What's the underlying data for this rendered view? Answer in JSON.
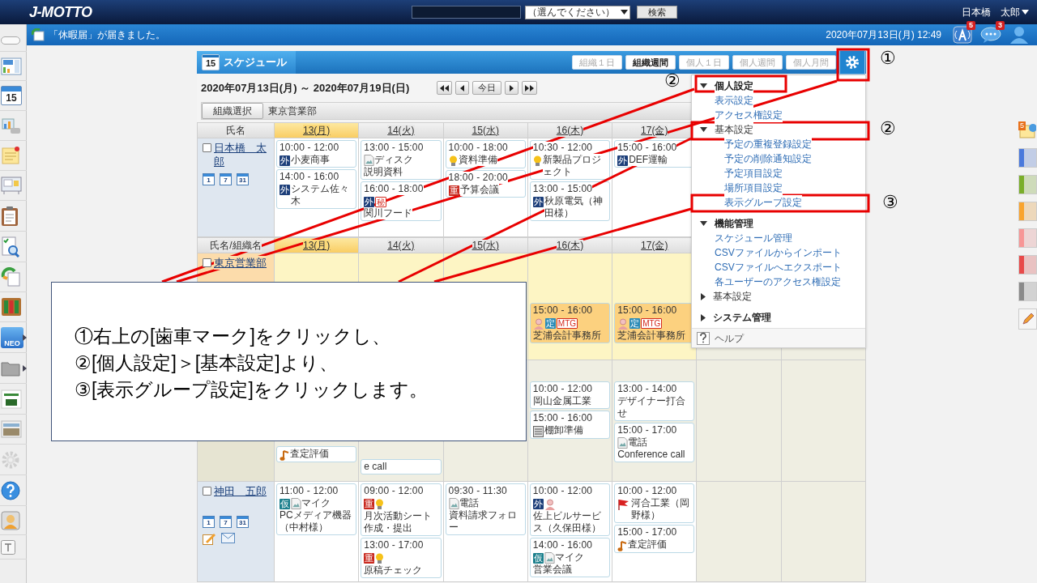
{
  "top_bar": {
    "logo": "J-MOTTO",
    "select": "（選んでください）",
    "search_button": "検索",
    "user": "日本橋　太郎"
  },
  "sidebar": {
    "items": [
      {
        "kind": "toggle",
        "submenu": false
      },
      {
        "kind": "portal",
        "submenu": false
      },
      {
        "kind": "calendar",
        "text": "15",
        "submenu": false
      },
      {
        "kind": "chart",
        "submenu": false
      },
      {
        "kind": "memo",
        "submenu": false
      },
      {
        "kind": "board",
        "submenu": false
      },
      {
        "kind": "clipboard",
        "submenu": false
      },
      {
        "kind": "search",
        "submenu": false
      },
      {
        "kind": "recycle",
        "submenu": false
      },
      {
        "kind": "binders",
        "submenu": false
      },
      {
        "kind": "neo",
        "text": "NEO",
        "submenu": true
      },
      {
        "kind": "folder",
        "submenu": true
      },
      {
        "kind": "banner",
        "submenu": false
      },
      {
        "kind": "photo",
        "submenu": false
      },
      {
        "kind": "gear",
        "submenu": false
      },
      {
        "kind": "help",
        "submenu": false
      },
      {
        "kind": "support",
        "submenu": false
      },
      {
        "kind": "text",
        "submenu": false
      }
    ]
  },
  "notice_bar": {
    "message": "「休暇届」が届きました。",
    "datetime": "2020年07月13日(月) 12:49",
    "icons": [
      {
        "kind": "antenna",
        "badge": "5"
      },
      {
        "kind": "chat",
        "badge": "3"
      },
      {
        "kind": "user"
      }
    ]
  },
  "schedule": {
    "calendar_day": "15",
    "title": "スケジュール",
    "views": [
      {
        "label": "組織１日",
        "selected": false
      },
      {
        "label": "組織週間",
        "selected": true
      },
      {
        "label": "個人１日",
        "selected": false
      },
      {
        "label": "個人週間",
        "selected": false
      },
      {
        "label": "個人月間",
        "selected": false
      }
    ],
    "range": "2020年07月13日(月) ～ 2020年07月19日(日)",
    "today_button": "今日",
    "org_button": "組織選択",
    "org": "東京営業部",
    "sections": [
      {
        "header": "氏名",
        "days": [
          {
            "label": "13(月)",
            "today": true
          },
          {
            "label": "14(火)",
            "today": false
          },
          {
            "label": "15(水)",
            "today": false
          },
          {
            "label": "16(木)",
            "today": false
          },
          {
            "label": "17(金)",
            "today": false
          }
        ],
        "rows": [
          {
            "kind": "person",
            "name": "日本橋　太郎",
            "checked": false,
            "links": [
              "1",
              "7",
              "31"
            ],
            "cells": [
              [
                {
                  "color": "#ffffff",
                  "time": "10:00 - 12:00",
                  "marks": [
                    {
                      "kind": "tag",
                      "text": "外",
                      "color": "#1d3f7a"
                    }
                  ],
                  "title": "小麦商事"
                },
                {
                  "color": "#ffffff",
                  "time": "14:00 - 16:00",
                  "marks": [
                    {
                      "kind": "tag",
                      "text": "外",
                      "color": "#1d3f7a"
                    }
                  ],
                  "title": "システム佐々木"
                }
              ],
              [
                {
                  "color": "#ffffff",
                  "time": "13:00 - 15:00",
                  "marks": [
                    {
                      "kind": "image",
                      "alt": "ディスク"
                    }
                  ],
                  "title": "説明資料"
                },
                {
                  "color": "#ffffff",
                  "time": "16:00 - 18:00",
                  "marks": [
                    {
                      "kind": "tag",
                      "text": "外",
                      "color": "#1d3f7a"
                    },
                    {
                      "kind": "outline",
                      "text": "秘",
                      "color": "#d42a1e"
                    }
                  ],
                  "title": "関川フード"
                }
              ],
              [
                {
                  "color": "#ffffff",
                  "time": "10:00 - 18:00",
                  "marks": [
                    {
                      "kind": "bulb"
                    }
                  ],
                  "title": "資料準備"
                },
                {
                  "color": "#ffffff",
                  "time": "18:00 - 20:00",
                  "marks": [
                    {
                      "kind": "tag",
                      "text": "重",
                      "color": "#c8281e"
                    }
                  ],
                  "title": "予算会議"
                }
              ],
              [
                {
                  "color": "#ffffff",
                  "time": "10:30 - 12:00",
                  "marks": [
                    {
                      "kind": "bulb"
                    }
                  ],
                  "title": "新製品プロジェクト"
                },
                {
                  "color": "#ffffff",
                  "time": "13:00 - 15:00",
                  "marks": [
                    {
                      "kind": "tag",
                      "text": "外",
                      "color": "#1d3f7a"
                    }
                  ],
                  "title": "秋原電気（神田様）"
                }
              ],
              [
                {
                  "color": "#ffffff",
                  "time": "15:00 - 16:00",
                  "marks": [
                    {
                      "kind": "tag",
                      "text": "外",
                      "color": "#1d3f7a"
                    }
                  ],
                  "title": "DEF運輸"
                }
              ]
            ]
          }
        ]
      },
      {
        "header": "氏名/組織名",
        "days": [
          {
            "label": "13(月)",
            "today": true
          },
          {
            "label": "14(火)",
            "today": false
          },
          {
            "label": "15(水)",
            "today": false
          },
          {
            "label": "16(木)",
            "today": false
          },
          {
            "label": "17(金)",
            "today": false
          }
        ],
        "rows": [
          {
            "kind": "group",
            "name": "東京営業部",
            "checked": false,
            "cells": [
              [],
              [],
              [],
              [
                {
                  "color": "#fcd17f",
                  "time": "15:00 - 16:00",
                  "marks": [
                    {
                      "kind": "person"
                    },
                    {
                      "kind": "tag",
                      "text": "定",
                      "color": "#2a8bb8"
                    },
                    {
                      "kind": "outline",
                      "text": "MTG",
                      "color": "#d42a1e"
                    }
                  ],
                  "title": "芝浦会計事務所"
                }
              ],
              [
                {
                  "color": "#fcd17f",
                  "time": "15:00 - 16:00",
                  "marks": [
                    {
                      "kind": "person"
                    },
                    {
                      "kind": "tag",
                      "text": "定",
                      "color": "#2a8bb8"
                    },
                    {
                      "kind": "outline",
                      "text": "MTG",
                      "color": "#d42a1e"
                    }
                  ],
                  "title": "芝浦会計事務所"
                }
              ]
            ]
          },
          {
            "kind": "covered",
            "cells": [
              [
                {
                  "color": "#ffffff",
                  "marks": [
                    {
                      "kind": "note"
                    }
                  ],
                  "title": "査定評価"
                }
              ],
              [
                {
                  "color": "#ffffff",
                  "title": "e call"
                }
              ],
              [],
              [
                {
                  "color": "#ffffff",
                  "time": "10:00 - 12:00",
                  "title": "岡山金属工業"
                },
                {
                  "color": "#ffffff",
                  "time": "15:00 - 16:00",
                  "marks": [
                    {
                      "kind": "stock"
                    }
                  ],
                  "title": "棚卸準備"
                }
              ],
              [
                {
                  "color": "#ffffff",
                  "time": "13:00 - 14:00",
                  "title": "デザイナー打合せ"
                },
                {
                  "color": "#ffffff",
                  "time": "15:00 - 17:00",
                  "marks": [
                    {
                      "kind": "image",
                      "alt": "電話"
                    }
                  ],
                  "title": "Conference call"
                }
              ]
            ]
          },
          {
            "kind": "person",
            "name": "神田　五郎",
            "checked": false,
            "links": [
              "1",
              "7",
              "31"
            ],
            "actions": [
              {
                "kind": "edit"
              },
              {
                "kind": "mail"
              }
            ],
            "cells": [
              [
                {
                  "color": "#ffffff",
                  "time": "11:00 - 12:00",
                  "marks": [
                    {
                      "kind": "tag",
                      "text": "仮",
                      "color": "#1b7f8c"
                    },
                    {
                      "kind": "image",
                      "alt": "マイク"
                    }
                  ],
                  "title": "PCメディア機器（中村様）"
                }
              ],
              [
                {
                  "color": "#ffffff",
                  "time": "09:00 - 12:00",
                  "marks": [
                    {
                      "kind": "tag",
                      "text": "重",
                      "color": "#c8281e"
                    },
                    {
                      "kind": "bulb"
                    }
                  ],
                  "title": "月次活動シート作成・提出"
                },
                {
                  "color": "#ffffff",
                  "time": "13:00 - 17:00",
                  "marks": [
                    {
                      "kind": "tag",
                      "text": "重",
                      "color": "#c8281e"
                    },
                    {
                      "kind": "bulb"
                    }
                  ],
                  "title": "原稿チェック"
                }
              ],
              [
                {
                  "color": "#ffffff",
                  "time": "09:30 - 11:30",
                  "marks": [
                    {
                      "kind": "image",
                      "alt": "電話"
                    }
                  ],
                  "title": "資料請求フォロー"
                }
              ],
              [
                {
                  "color": "#ffffff",
                  "time": "10:00 - 12:00",
                  "marks": [
                    {
                      "kind": "tag",
                      "text": "外",
                      "color": "#1d3f7a"
                    },
                    {
                      "kind": "person"
                    }
                  ],
                  "title": "佐上ビルサービス（久保田様）"
                },
                {
                  "color": "#ffffff",
                  "time": "14:00 - 16:00",
                  "marks": [
                    {
                      "kind": "tag",
                      "text": "仮",
                      "color": "#1b7f8c"
                    },
                    {
                      "kind": "image",
                      "alt": "マイク"
                    }
                  ],
                  "title": "営業会議"
                }
              ],
              [
                {
                  "color": "#ffffff",
                  "time": "10:00 - 12:00",
                  "marks": [
                    {
                      "kind": "flag"
                    }
                  ],
                  "title": "河合工業（岡野様）"
                },
                {
                  "color": "#ffffff",
                  "time": "15:00 - 17:00",
                  "marks": [
                    {
                      "kind": "note"
                    }
                  ],
                  "title": "査定評価"
                }
              ]
            ]
          }
        ]
      }
    ]
  },
  "settings_menu": {
    "items": [
      {
        "label": "個人設定",
        "expanded": true,
        "children": [
          {
            "label": "表示設定"
          },
          {
            "label": "アクセス権設定"
          },
          {
            "label": "基本設定",
            "expanded": true,
            "children": [
              {
                "label": "予定の重複登録設定"
              },
              {
                "label": "予定の削除通知設定"
              },
              {
                "label": "予定項目設定"
              },
              {
                "label": "場所項目設定"
              },
              {
                "label": "表示グループ設定"
              }
            ]
          }
        ]
      },
      {
        "label": "機能管理",
        "expanded": true,
        "children": [
          {
            "label": "スケジュール管理"
          },
          {
            "label": "CSVファイルからインポート"
          },
          {
            "label": "CSVファイルへエクスポート"
          },
          {
            "label": "各ユーザーのアクセス権設定"
          },
          {
            "label": "基本設定",
            "expanded": false
          }
        ]
      },
      {
        "label": "システム管理",
        "expanded": false
      }
    ],
    "help": "ヘルプ"
  },
  "right_strip": [
    {
      "kind": "memo",
      "badge": "5"
    },
    {
      "kind": "swatch",
      "color": "#4a79dc"
    },
    {
      "kind": "swatch",
      "color": "#7aae2a"
    },
    {
      "kind": "swatch",
      "color": "#f9a42e"
    },
    {
      "kind": "swatch",
      "color": "#f79696"
    },
    {
      "kind": "swatch",
      "color": "#e84a4a"
    },
    {
      "kind": "swatch",
      "color": "#8a8a8a"
    },
    {
      "kind": "pencil"
    }
  ],
  "annotations": {
    "markers": [
      {
        "text": "①"
      },
      {
        "text": "②"
      },
      {
        "text": "②"
      },
      {
        "text": "③"
      }
    ],
    "callout": [
      "①右上の[歯車マーク]をクリックし、",
      "②[個人設定]＞[基本設定]より、",
      "③[表示グループ設定]をクリックします。"
    ]
  }
}
